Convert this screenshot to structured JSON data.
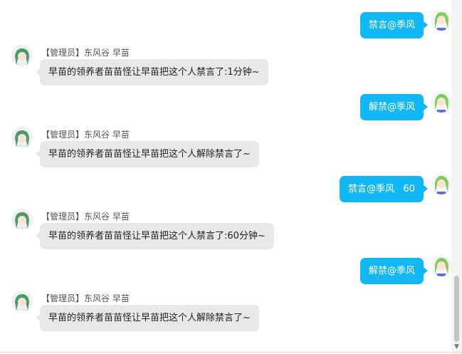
{
  "messages": [
    {
      "side": "out",
      "text": "禁言@季风"
    },
    {
      "side": "in",
      "sender": "【管理员】东风谷 早苗",
      "text": "早苗的领养者苗苗怪让早苗把这个人禁言了:1分钟~"
    },
    {
      "side": "out",
      "text": "解禁@季风"
    },
    {
      "side": "in",
      "sender": "【管理员】东风谷 早苗",
      "text": "早苗的领养者苗苗怪让早苗把这个人解除禁言了~"
    },
    {
      "side": "out",
      "text": "禁言@季风   60"
    },
    {
      "side": "in",
      "sender": "【管理员】东风谷 早苗",
      "text": "早苗的领养者苗苗怪让早苗把这个人禁言了:60分钟~"
    },
    {
      "side": "out",
      "text": "解禁@季风"
    },
    {
      "side": "in",
      "sender": "【管理员】东风谷 早苗",
      "text": "早苗的领养者苗苗怪让早苗把这个人解除禁言了~"
    }
  ],
  "colors": {
    "outgoing_bubble": "#12b7f5",
    "incoming_bubble": "#e8e8e8",
    "avatar_hair": "#7ccf5a"
  },
  "icons": {
    "avatar": "user-avatar-icon",
    "scroll_down": "chevron-down-icon"
  }
}
